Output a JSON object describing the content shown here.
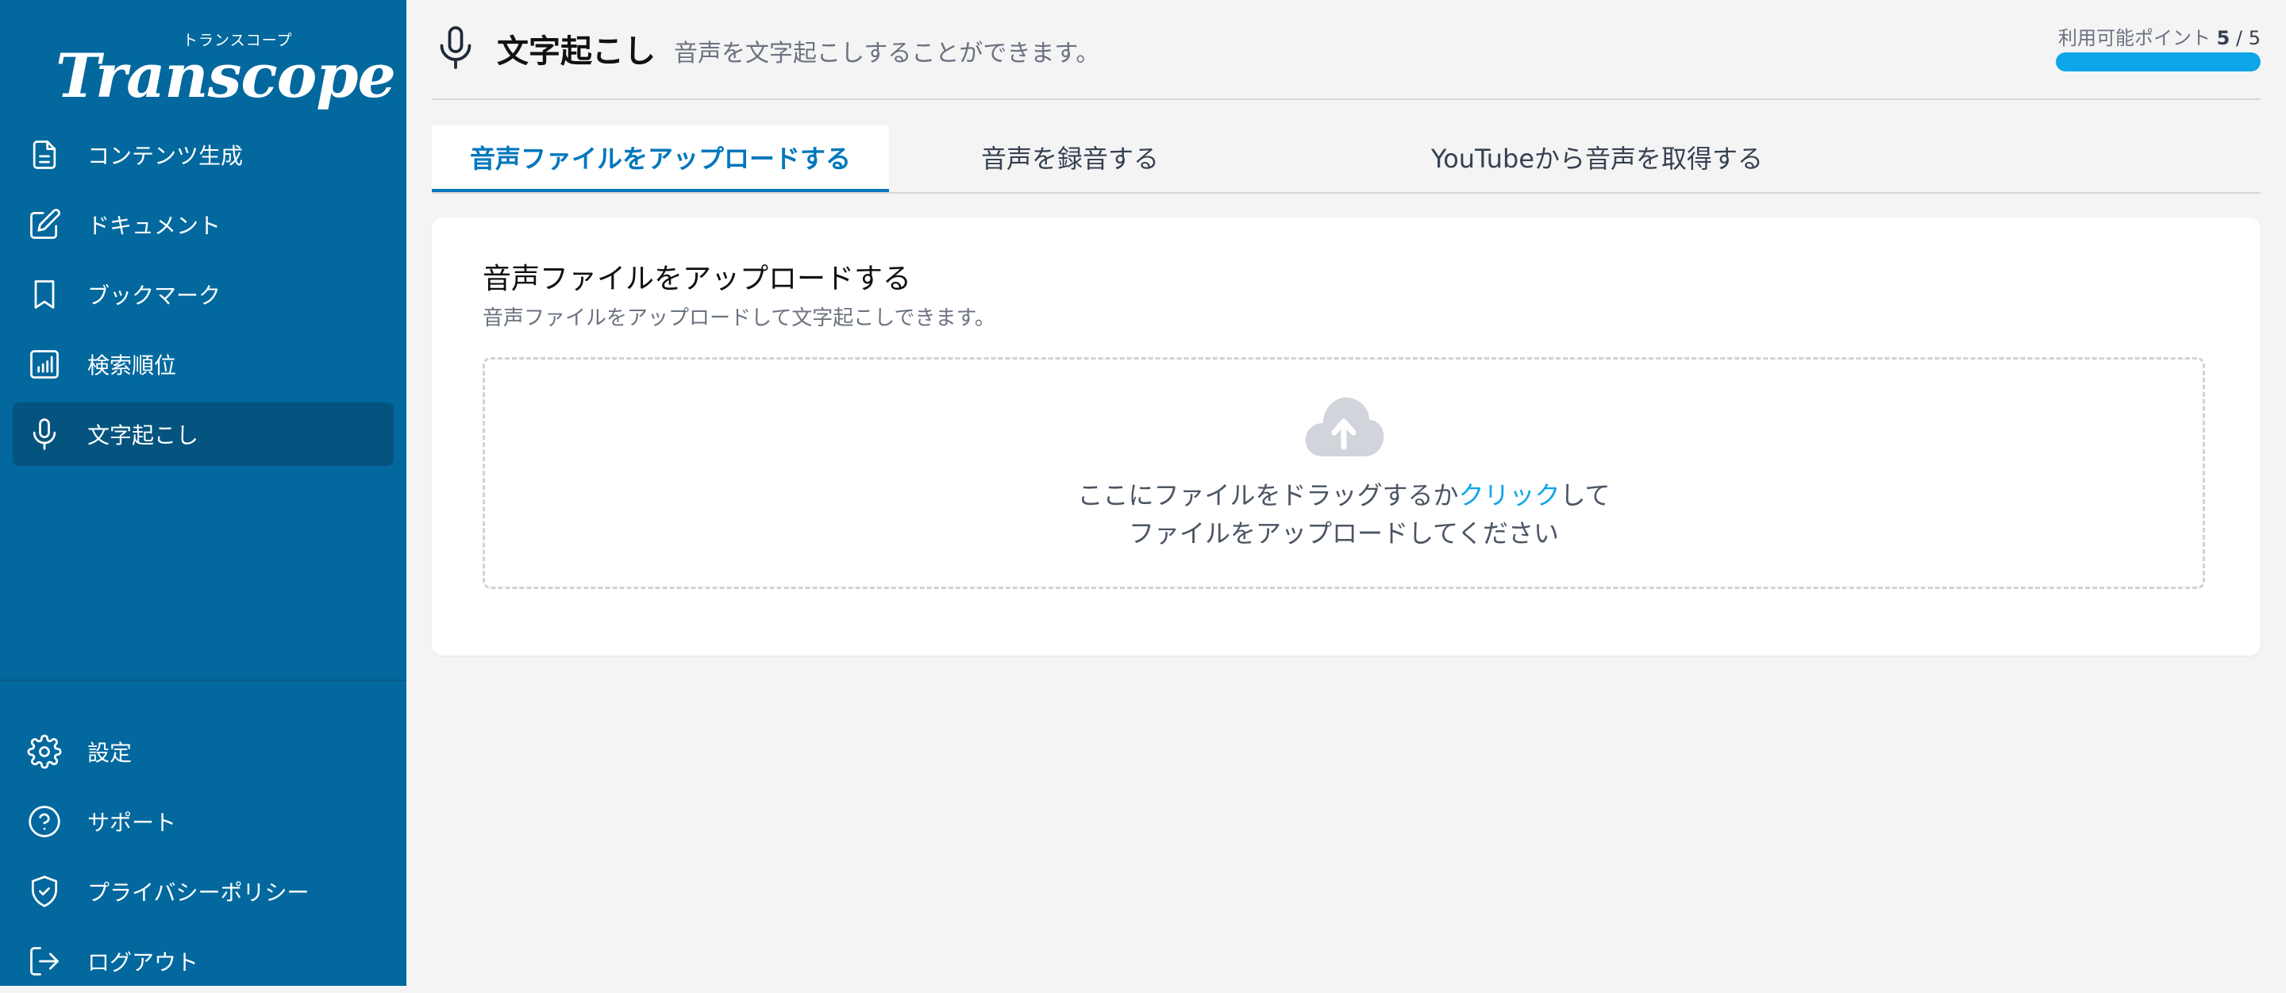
{
  "brand": {
    "kana": "トランスコープ",
    "name": "Transcope"
  },
  "sidebar": {
    "items": [
      {
        "label": "コンテンツ生成",
        "icon": "document-icon"
      },
      {
        "label": "ドキュメント",
        "icon": "edit-icon"
      },
      {
        "label": "ブックマーク",
        "icon": "bookmark-icon"
      },
      {
        "label": "検索順位",
        "icon": "chart-icon"
      },
      {
        "label": "文字起こし",
        "icon": "microphone-icon",
        "active": true
      }
    ],
    "bottom_items": [
      {
        "label": "設定",
        "icon": "gear-icon"
      },
      {
        "label": "サポート",
        "icon": "help-icon"
      },
      {
        "label": "プライバシーポリシー",
        "icon": "shield-icon"
      },
      {
        "label": "ログアウト",
        "icon": "logout-icon"
      }
    ]
  },
  "header": {
    "icon": "microphone-icon",
    "title": "文字起こし",
    "subtitle": "音声を文字起こしすることができます。",
    "points_label": "利用可能ポイント",
    "points_used": "5",
    "points_sep": "/",
    "points_total": "5",
    "points_fraction": 1.0
  },
  "tabs": [
    {
      "label": "音声ファイルをアップロードする",
      "active": true
    },
    {
      "label": "音声を録音する",
      "active": false
    },
    {
      "label": "YouTubeから音声を取得する",
      "active": false
    }
  ],
  "card": {
    "title": "音声ファイルをアップロードする",
    "subtitle": "音声ファイルをアップロードして文字起こしできます。",
    "dropzone": {
      "icon": "cloud-upload-icon",
      "line1_before": "ここにファイルをドラッグするか",
      "line1_link": "クリック",
      "line1_after": "して",
      "line2": "ファイルをアップロードしてください"
    }
  },
  "colors": {
    "sidebar_bg": "#02689e",
    "sidebar_active": "#04547f",
    "accent": "#0277bd",
    "link": "#0ea5e9"
  }
}
